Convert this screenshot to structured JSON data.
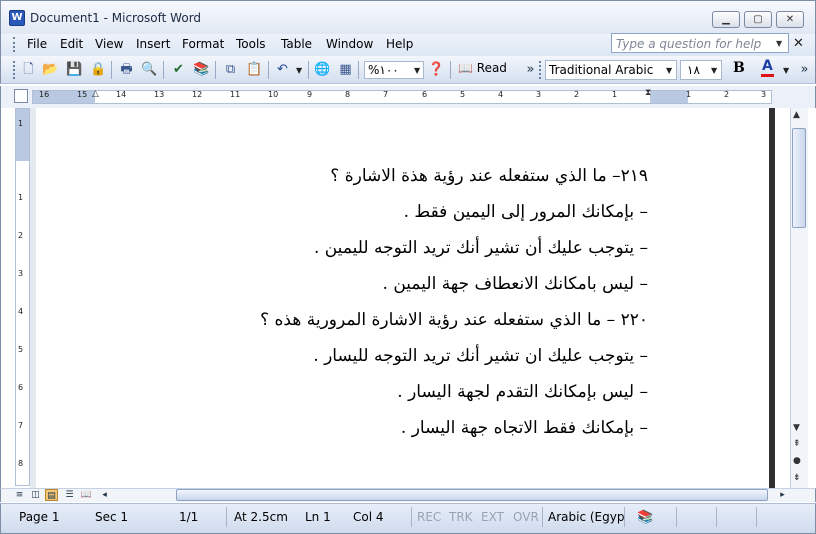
{
  "window": {
    "title": "Document1 - Microsoft Word",
    "icon": "W"
  },
  "menu": [
    "File",
    "Edit",
    "View",
    "Insert",
    "Format",
    "Tools",
    "Table",
    "Window",
    "Help"
  ],
  "help_placeholder": "Type a question for help",
  "toolbar": {
    "zoom": "%١٠٠",
    "read_label": "Read",
    "font_name": "Traditional Arabic",
    "font_size": "١٨",
    "bold_label": "B",
    "color_label": "A"
  },
  "ruler": {
    "marks": [
      "16",
      "15",
      "14",
      "13",
      "12",
      "11",
      "10",
      "9",
      "8",
      "7",
      "6",
      "5",
      "4",
      "3",
      "2",
      "1",
      "1",
      "2",
      "3"
    ]
  },
  "vruler": {
    "marks": [
      "1",
      "1",
      "2",
      "3",
      "4",
      "5",
      "6",
      "7",
      "8"
    ]
  },
  "document": {
    "lines": [
      "٢١٩– ما الذي ستفعله عند رؤية هذة الاشارة ؟",
      "– بإمكانك المرور إلى اليمين فقط .",
      "– يتوجب عليك أن تشير أنك تريد التوجه لليمين .",
      "– ليس بامكانك الانعطاف جهة اليمين .",
      "٢٢٠ – ما الذي ستفعله عند رؤية الاشارة المرورية هذه ؟",
      "– يتوجب عليك ان تشير أنك تريد التوجه لليسار .",
      "– ليس بإمكانك التقدم لجهة اليسار .",
      "– بإمكانك فقط الاتجاه جهة اليسار ."
    ]
  },
  "status": {
    "page": "Page 1",
    "sec": "Sec 1",
    "pages": "1/1",
    "at": "At 2.5cm",
    "ln": "Ln 1",
    "col": "Col 4",
    "rec": "REC",
    "trk": "TRK",
    "ext": "EXT",
    "ovr": "OVR",
    "language": "Arabic (Egyp"
  }
}
